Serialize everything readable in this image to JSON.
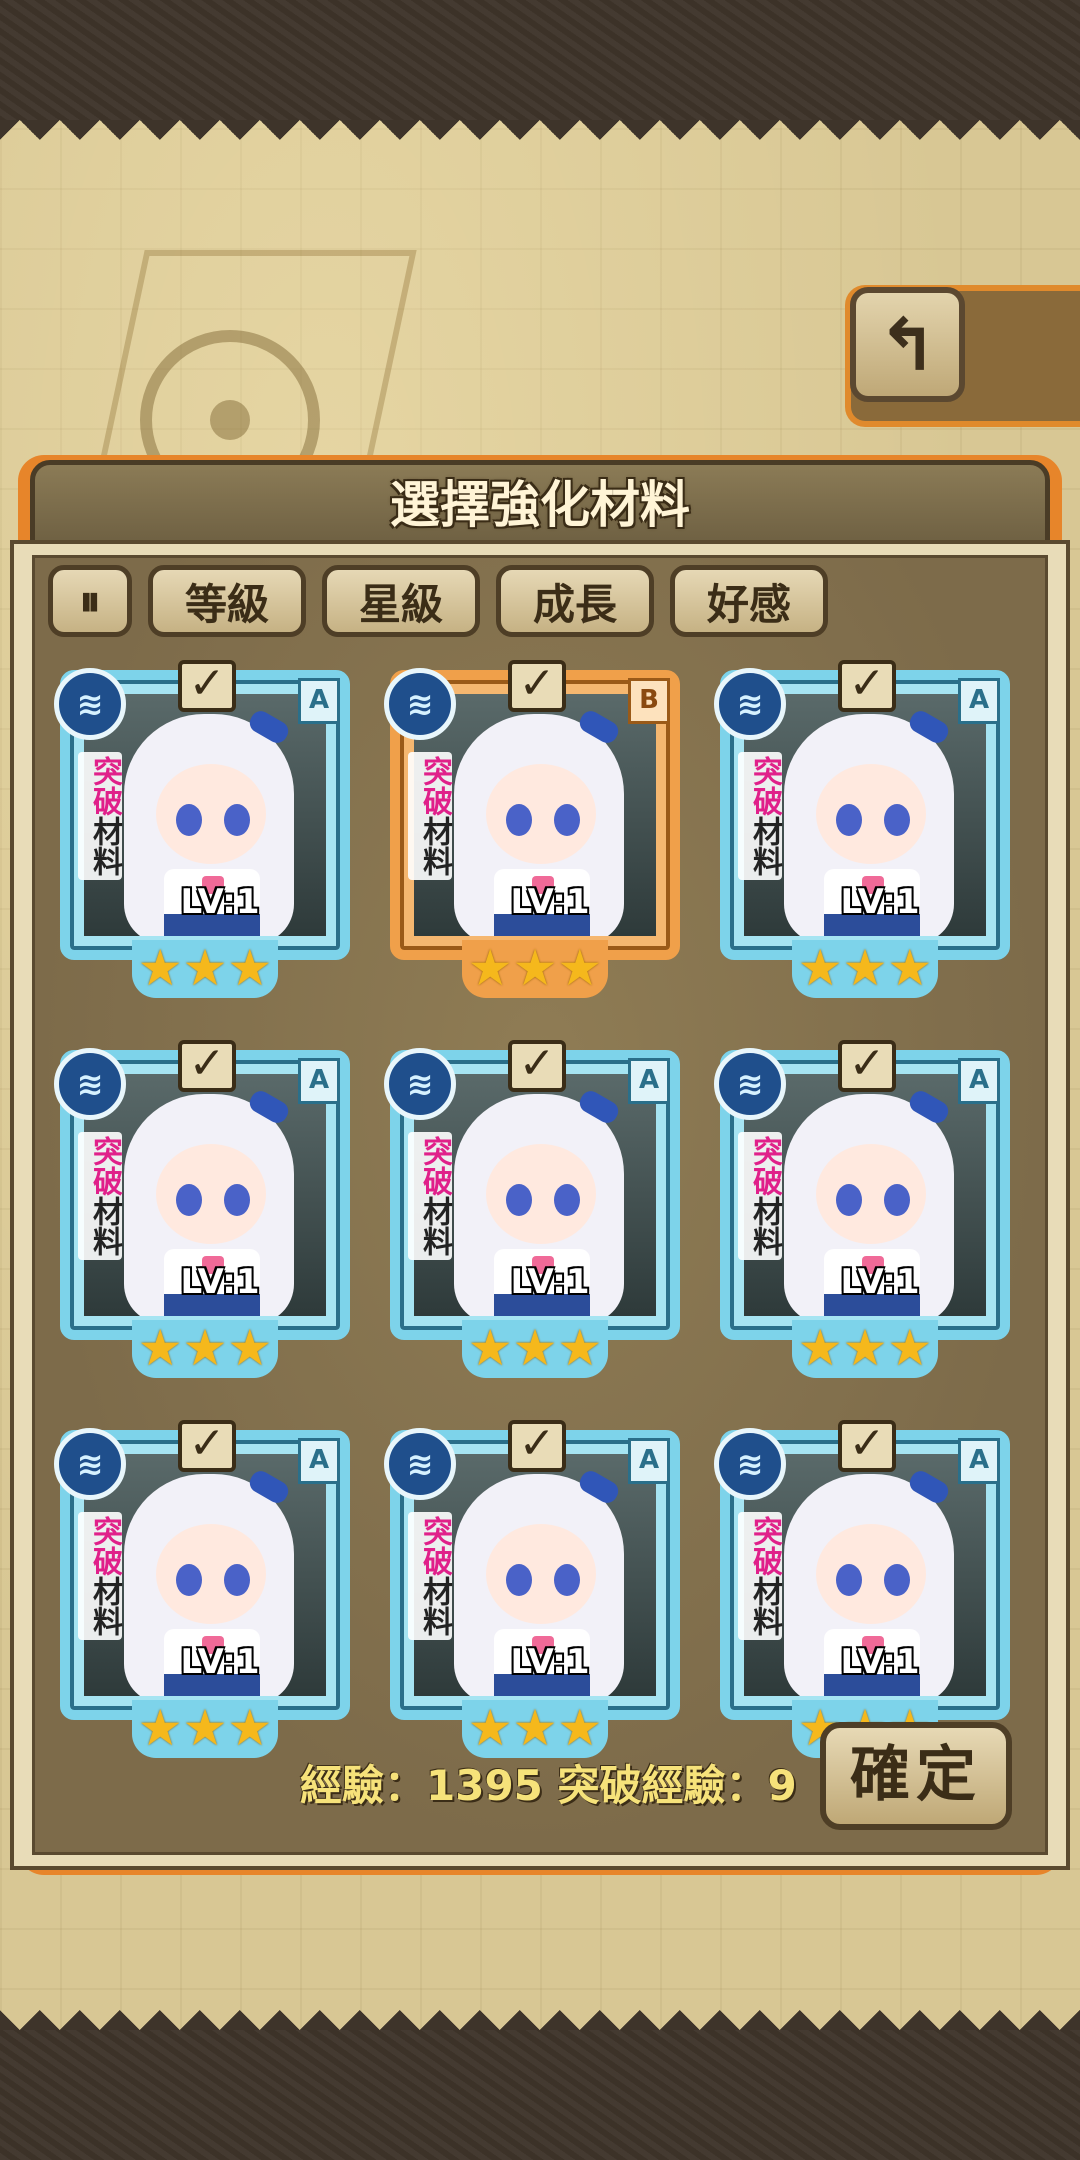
{
  "header": {
    "title": "選擇強化材料",
    "back_icon": "return-icon"
  },
  "filters": {
    "sort_icon": "sort-toggle-icon",
    "items": [
      "等級",
      "星級",
      "成長",
      "好感"
    ]
  },
  "cards": [
    {
      "rank": "A",
      "level": "LV:1",
      "tag_top": "突破",
      "tag_bottom": "材料",
      "stars": "★★★",
      "selected": true,
      "color": "blue"
    },
    {
      "rank": "B",
      "level": "LV:1",
      "tag_top": "突破",
      "tag_bottom": "材料",
      "stars": "★★★",
      "selected": true,
      "color": "orange"
    },
    {
      "rank": "A",
      "level": "LV:1",
      "tag_top": "突破",
      "tag_bottom": "材料",
      "stars": "★★★",
      "selected": true,
      "color": "blue"
    },
    {
      "rank": "A",
      "level": "LV:1",
      "tag_top": "突破",
      "tag_bottom": "材料",
      "stars": "★★★",
      "selected": true,
      "color": "blue"
    },
    {
      "rank": "A",
      "level": "LV:1",
      "tag_top": "突破",
      "tag_bottom": "材料",
      "stars": "★★★",
      "selected": true,
      "color": "blue"
    },
    {
      "rank": "A",
      "level": "LV:1",
      "tag_top": "突破",
      "tag_bottom": "材料",
      "stars": "★★★",
      "selected": true,
      "color": "blue"
    },
    {
      "rank": "A",
      "level": "LV:1",
      "tag_top": "突破",
      "tag_bottom": "材料",
      "stars": "★★★",
      "selected": true,
      "color": "blue"
    },
    {
      "rank": "A",
      "level": "LV:1",
      "tag_top": "突破",
      "tag_bottom": "材料",
      "stars": "★★★",
      "selected": true,
      "color": "blue"
    },
    {
      "rank": "A",
      "level": "LV:1",
      "tag_top": "突破",
      "tag_bottom": "材料",
      "stars": "★★★",
      "selected": true,
      "color": "blue"
    }
  ],
  "footer": {
    "exp_text": "經驗：1395  突破經驗：9",
    "confirm_label": "確定"
  },
  "colors": {
    "accent": "#e7852a",
    "card_blue": "#7dd3ea",
    "card_orange": "#f0a04a",
    "exp_text": "#f6e27a"
  }
}
